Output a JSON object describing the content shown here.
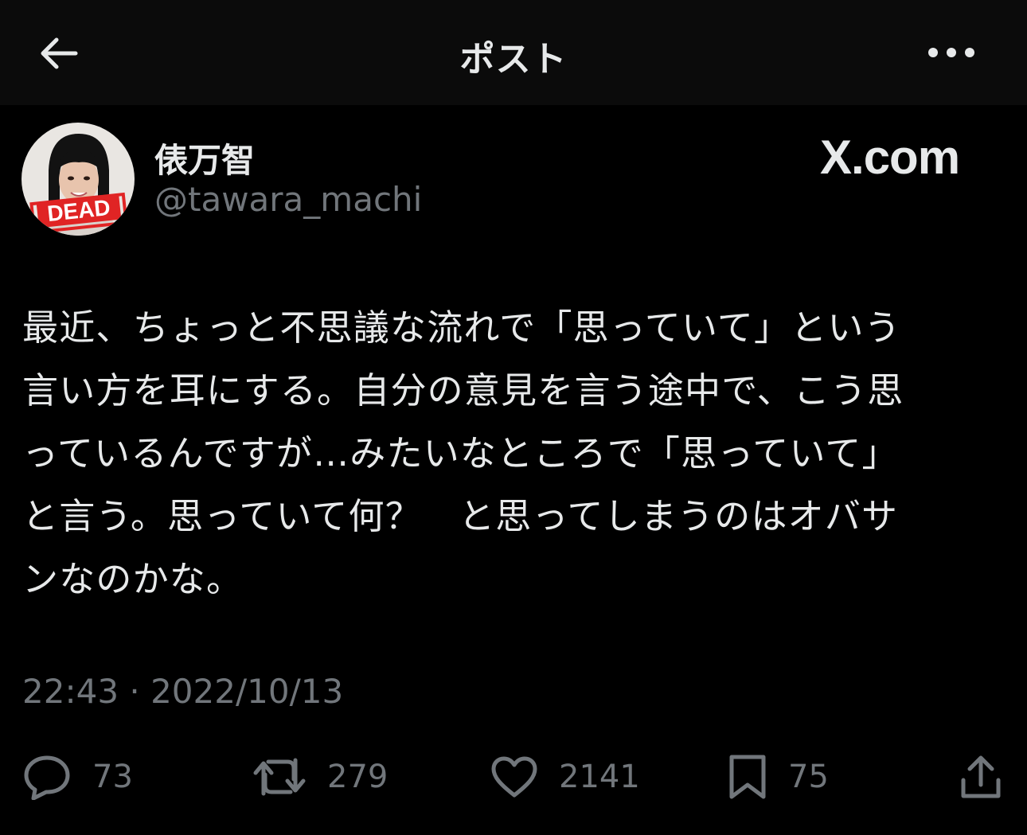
{
  "header": {
    "title": "ポスト",
    "back_icon": "back-arrow-icon",
    "more_icon": "more-dots-icon"
  },
  "author": {
    "name": "俵万智",
    "handle": "@tawara_machi",
    "avatar_badge": "DEAD"
  },
  "brand": {
    "text": "X.com"
  },
  "tweet": {
    "text": "最近、ちょっと不思議な流れで「思っていて」という\n言い方を耳にする。自分の意見を言う途中で、こう思\nっているんですが…みたいなところで「思っていて」\nと言う。思っていて何？　と思ってしまうのはオバサ\nンなのかな。",
    "timestamp": "22:43 · 2022/10/13"
  },
  "actions": {
    "reply_count": "73",
    "repost_count": "279",
    "like_count": "2141",
    "bookmark_count": "75"
  },
  "colors": {
    "background": "#000000",
    "header_background": "#0b0b0b",
    "text_primary": "#e7e9ea",
    "text_secondary": "#71767b"
  }
}
